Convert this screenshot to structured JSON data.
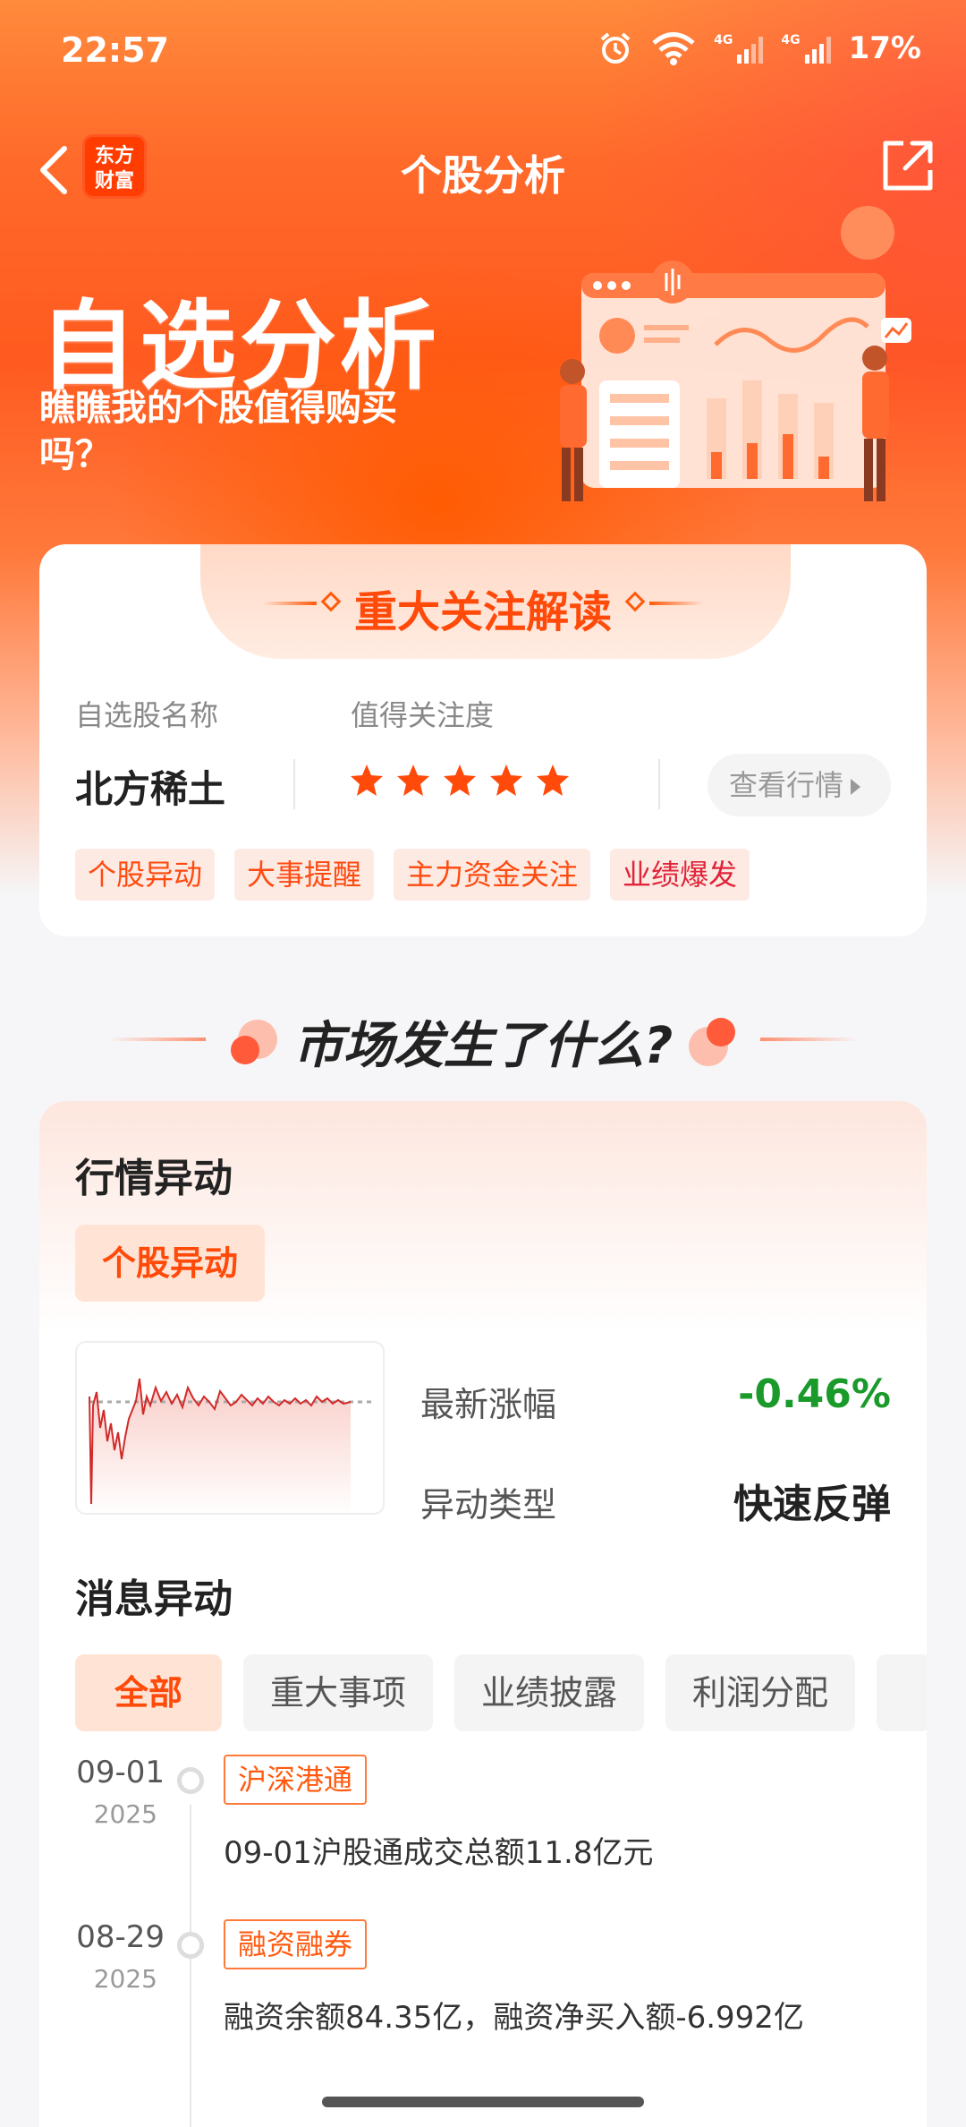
{
  "status_bar": {
    "time": "22:57",
    "battery": "17%",
    "net1": "4G",
    "net2": "4G"
  },
  "nav": {
    "title": "个股分析",
    "logo_line1": "东方",
    "logo_line2": "财富"
  },
  "banner": {
    "title": "自选分析",
    "subtitle": "瞧瞧我的个股值得购买吗？"
  },
  "focus_card": {
    "title": "重大关注解读",
    "name_label": "自选股名称",
    "attention_label": "值得关注度",
    "stock_name": "北方稀土",
    "rating": 5,
    "view_button": "查看行情",
    "tags": [
      "个股异动",
      "大事提醒",
      "主力资金关注",
      "业绩爆发"
    ]
  },
  "market_section": {
    "title": "市场发生了什么?"
  },
  "market_card": {
    "title": "行情异动",
    "chip": "个股异动",
    "latest_change_label": "最新涨幅",
    "latest_change_value": "-0.46%",
    "type_label": "异动类型",
    "type_value": "快速反弹",
    "news_title": "消息异动",
    "filters": [
      "全部",
      "重大事项",
      "业绩披露",
      "利润分配"
    ],
    "news": [
      {
        "date": "09-01",
        "year": "2025",
        "tag": "沪深港通",
        "text": "09-01沪股通成交总额11.8亿元"
      },
      {
        "date": "08-29",
        "year": "2025",
        "tag": "融资融券",
        "text": "融资余额84.35亿，融资净买入额-6.992亿"
      }
    ]
  },
  "colors": {
    "accent": "#ff4a0a",
    "down": "#1a9a2a",
    "star": "#ff4a0a"
  }
}
